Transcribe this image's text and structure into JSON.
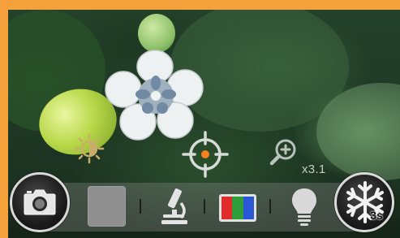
{
  "app": {
    "border_color": "#f4a13c"
  },
  "icons": {
    "brightness": "brightness-icon",
    "focus": "focus-crosshair-icon",
    "zoom": "zoom-in-icon",
    "camera": "camera-icon",
    "microscope": "microscope-icon",
    "color_mode": "rgb-color-icon",
    "light": "light-bulb-icon",
    "freeze": "snowflake-icon"
  },
  "overlay": {
    "zoom_level": "x3.1",
    "focus_point_color": "#f5821f"
  },
  "toolbar": {
    "timer_label": "3s",
    "color_mode_colors": [
      "#e12b2b",
      "#2f9e3a",
      "#2b57d6"
    ]
  }
}
